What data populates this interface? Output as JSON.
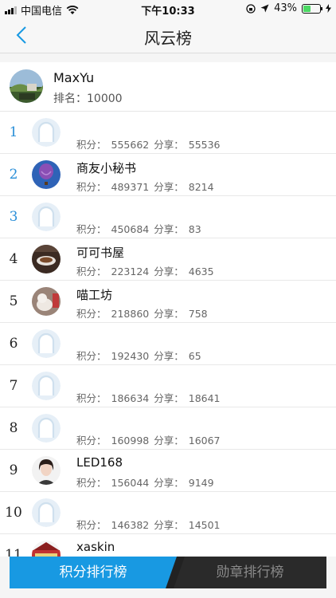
{
  "status_bar": {
    "carrier": "中国电信",
    "time": "下午10:33",
    "battery": "43%",
    "battery_level": 0.43
  },
  "nav": {
    "title": "风云榜"
  },
  "me": {
    "name": "MaxYu",
    "rank_text": "排名：10000"
  },
  "labels": {
    "points": "积分：",
    "shares": "分享："
  },
  "colors": {
    "accent": "#1899e2",
    "rank_top": "#2a8fd8"
  },
  "ranking": [
    {
      "rank": "1",
      "name": "",
      "points": "555662",
      "shares": "55536",
      "avatar": "default-avatar"
    },
    {
      "rank": "2",
      "name": "商友小秘书",
      "points": "489371",
      "shares": "8214",
      "avatar": "balloon-avatar"
    },
    {
      "rank": "3",
      "name": "",
      "points": "450684",
      "shares": "83",
      "avatar": "default-avatar"
    },
    {
      "rank": "4",
      "name": "可可书屋",
      "points": "223124",
      "shares": "4635",
      "avatar": "coffee-avatar"
    },
    {
      "rank": "5",
      "name": "喵工坊",
      "points": "218860",
      "shares": "758",
      "avatar": "cat-avatar"
    },
    {
      "rank": "6",
      "name": "",
      "points": "192430",
      "shares": "65",
      "avatar": "default-avatar"
    },
    {
      "rank": "7",
      "name": "",
      "points": "186634",
      "shares": "18641",
      "avatar": "default-avatar"
    },
    {
      "rank": "8",
      "name": "",
      "points": "160998",
      "shares": "16067",
      "avatar": "default-avatar"
    },
    {
      "rank": "9",
      "name": "LED168",
      "points": "156044",
      "shares": "9149",
      "avatar": "person-avatar"
    },
    {
      "rank": "10",
      "name": "",
      "points": "146382",
      "shares": "14501",
      "avatar": "default-avatar"
    },
    {
      "rank": "11",
      "name": "xaskin",
      "points": "",
      "shares": "",
      "avatar": "building-avatar"
    }
  ],
  "tabs": {
    "active": "积分排行榜",
    "inactive": "勋章排行榜"
  }
}
